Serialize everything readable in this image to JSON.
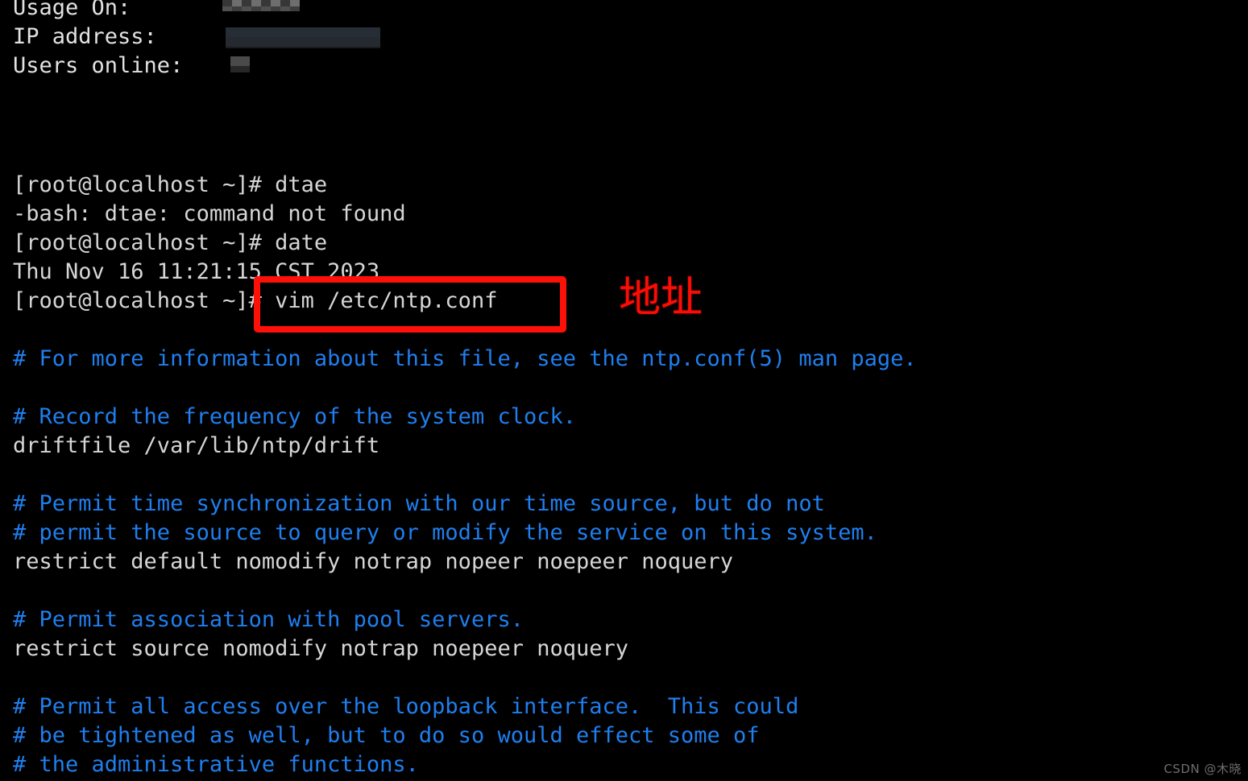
{
  "terminal": {
    "background_color": "#000000",
    "text_color": "#d6d6d6",
    "comment_color": "#1f7fef",
    "annotation_color": "#fd1008",
    "motd": {
      "rows": [
        {
          "label": "Usage On:",
          "value_redacted": true
        },
        {
          "label": "IP address:",
          "value_redacted": true
        },
        {
          "label": "Users online:",
          "value_redacted": true
        }
      ]
    },
    "session_lines": [
      {
        "kind": "prompt",
        "text": "[root@localhost ~]# dtae"
      },
      {
        "kind": "output",
        "text": "-bash: dtae: command not found"
      },
      {
        "kind": "prompt",
        "text": "[root@localhost ~]# date"
      },
      {
        "kind": "output",
        "text": "Thu Nov 16 11:21:15 CST 2023"
      },
      {
        "kind": "prompt",
        "text": "[root@localhost ~]# vim /etc/ntp.conf"
      }
    ],
    "prompt_fragment_left": "[root@localhost ~]",
    "highlighted_command": "# vim /etc/ntp.conf",
    "file_lines": [
      {
        "kind": "comment",
        "text": "# For more information about this file, see the ntp.conf(5) man page."
      },
      {
        "kind": "blank",
        "text": ""
      },
      {
        "kind": "comment",
        "text": "# Record the frequency of the system clock."
      },
      {
        "kind": "config",
        "text": "driftfile /var/lib/ntp/drift"
      },
      {
        "kind": "blank",
        "text": ""
      },
      {
        "kind": "comment",
        "text": "# Permit time synchronization with our time source, but do not"
      },
      {
        "kind": "comment",
        "text": "# permit the source to query or modify the service on this system."
      },
      {
        "kind": "config",
        "text": "restrict default nomodify notrap nopeer noepeer noquery"
      },
      {
        "kind": "blank",
        "text": ""
      },
      {
        "kind": "comment",
        "text": "# Permit association with pool servers."
      },
      {
        "kind": "config",
        "text": "restrict source nomodify notrap noepeer noquery"
      },
      {
        "kind": "blank",
        "text": ""
      },
      {
        "kind": "comment",
        "text": "# Permit all access over the loopback interface.  This could"
      },
      {
        "kind": "comment",
        "text": "# be tightened as well, but to do so would effect some of"
      },
      {
        "kind": "comment",
        "text": "# the administrative functions."
      }
    ]
  },
  "annotation": {
    "label": "地址",
    "color": "#fb0d05"
  },
  "watermark": {
    "text": "CSDN @木晓"
  }
}
